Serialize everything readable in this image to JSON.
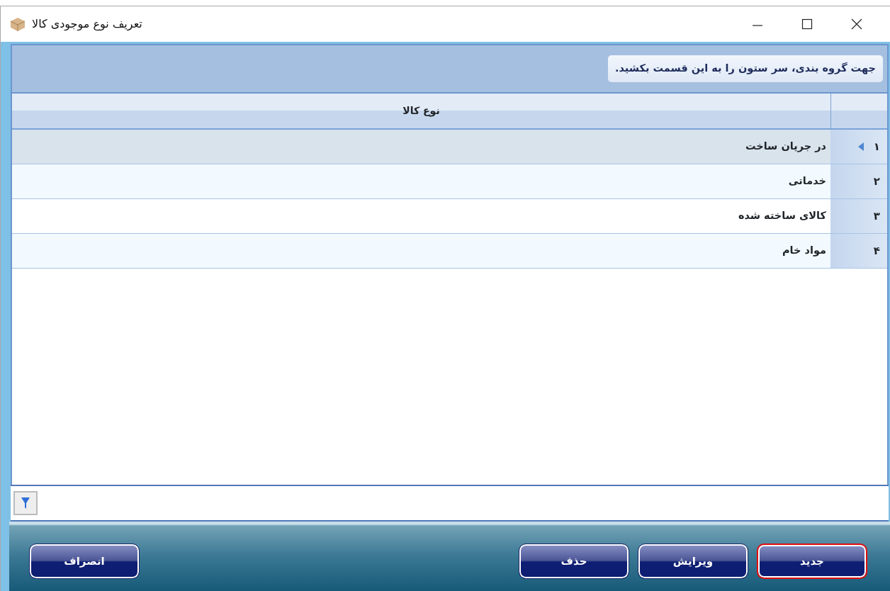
{
  "window": {
    "title": "تعریف نوع موجودی کالا"
  },
  "group_panel": {
    "hint": "جهت گروه بندی، سر ستون را به این قسمت بکشید."
  },
  "table": {
    "columns": [
      "نوع کالا"
    ],
    "rows": [
      {
        "number": "۱",
        "type": "در جریان ساخت",
        "selected": true
      },
      {
        "number": "۲",
        "type": "خدماتی",
        "selected": false
      },
      {
        "number": "۳",
        "type": "کالای ساخته شده",
        "selected": false
      },
      {
        "number": "۴",
        "type": "مواد خام",
        "selected": false
      }
    ]
  },
  "buttons": [
    {
      "label": "جدید",
      "focused": true
    },
    {
      "label": "ویرایش",
      "focused": false
    },
    {
      "label": "حذف",
      "focused": false
    },
    {
      "label": "انصراف",
      "focused": false
    }
  ]
}
